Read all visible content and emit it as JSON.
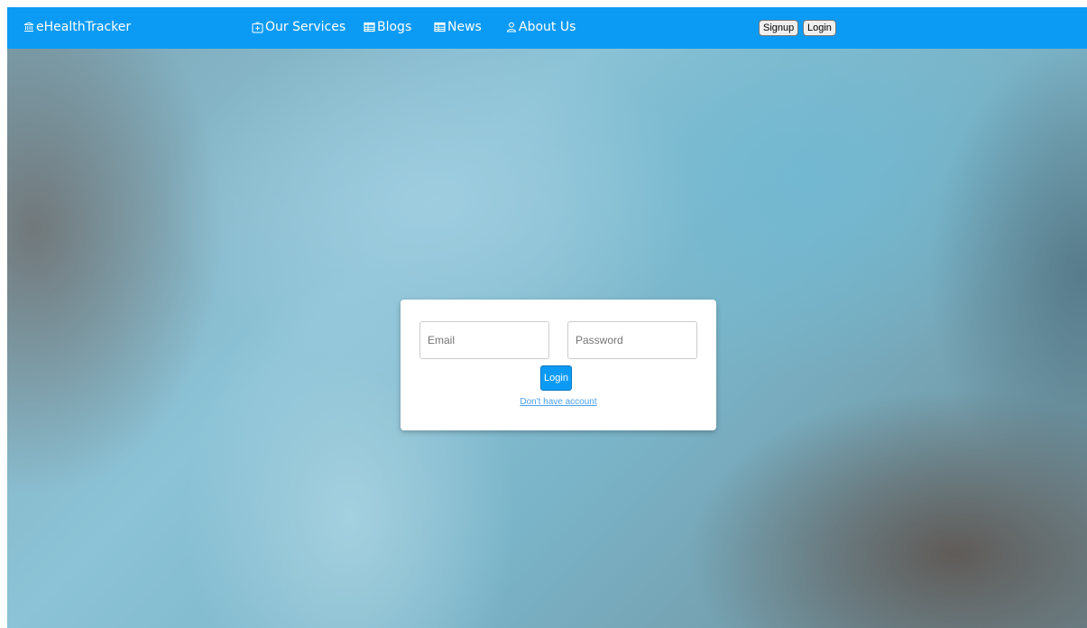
{
  "navbar": {
    "brand": {
      "label": "eHealthTracker",
      "icon": "bank-icon"
    },
    "items": [
      {
        "label": "Our Services",
        "icon": "plus-square-icon"
      },
      {
        "label": "Blogs",
        "icon": "table-icon"
      },
      {
        "label": "News",
        "icon": "table-icon"
      },
      {
        "label": "About Us",
        "icon": "person-icon"
      }
    ],
    "signup_label": "Signup",
    "login_label": "Login"
  },
  "login_form": {
    "email_placeholder": "Email",
    "password_placeholder": "Password",
    "submit_label": "Login",
    "no_account_link": "Don't have account"
  },
  "colors": {
    "navbar_bg": "#0b9bf5",
    "accent": "#0b9bf5",
    "link": "#4aa0f0",
    "card_bg": "#ffffff"
  }
}
